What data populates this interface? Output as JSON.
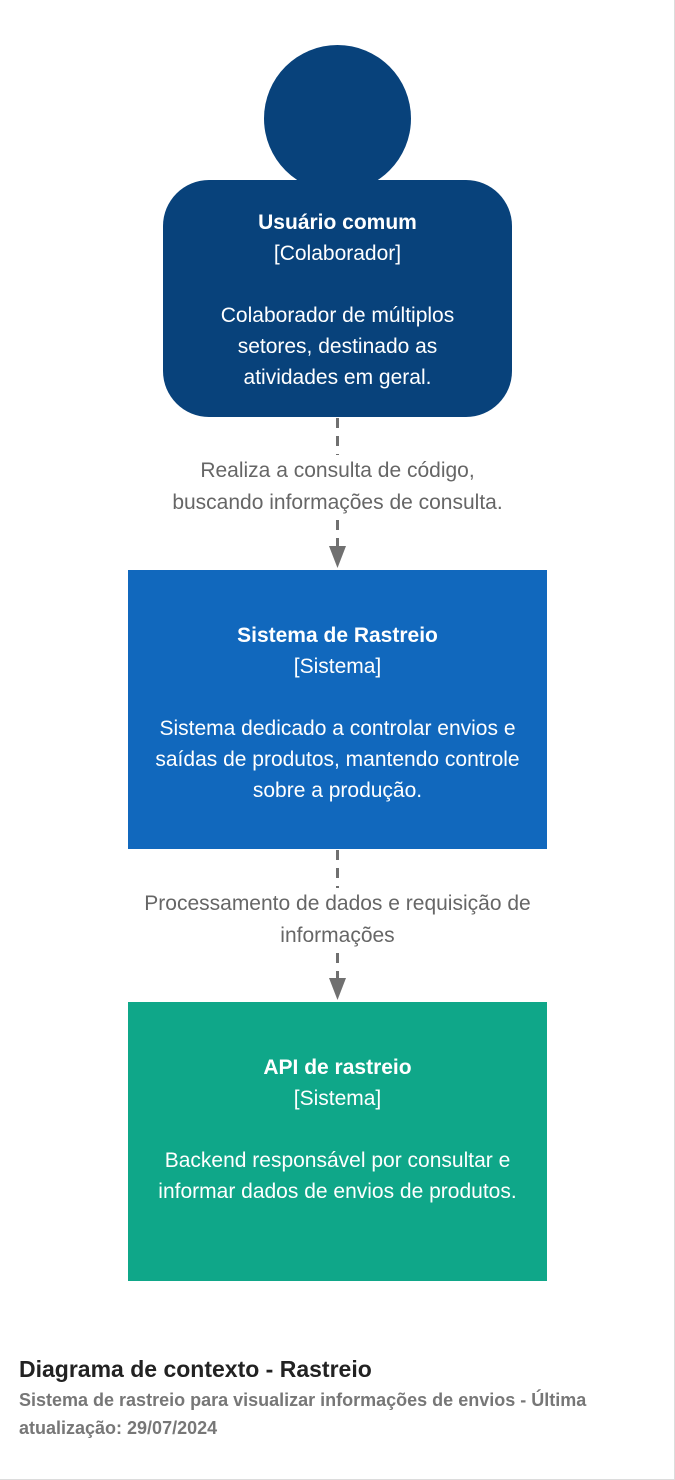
{
  "person": {
    "name": "Usuário comum",
    "type": "[Colaborador]",
    "description": "Colaborador de múltiplos setores, destinado as atividades em geral."
  },
  "system": {
    "name": "Sistema de Rastreio",
    "type": "[Sistema]",
    "description": "Sistema dedicado a controlar envios e saídas de produtos, mantendo controle sobre a produção."
  },
  "api": {
    "name": "API de rastreio",
    "type": "[Sistema]",
    "description": "Backend responsável por consultar e informar dados de envios de produtos."
  },
  "relations": [
    {
      "line1": "Realiza a consulta de código,",
      "line2": "buscando informações de consulta."
    },
    {
      "line1": "Processamento de dados e requisição de",
      "line2": "informações"
    }
  ],
  "footer": {
    "title": "Diagrama de contexto - Rastreio",
    "subtitle": "Sistema de rastreio para visualizar informações de envios - Última atualização: 29/07/2024"
  },
  "colors": {
    "person": "#08427b",
    "system": "#1168bd",
    "api": "#0fa789",
    "relation": "#707070"
  }
}
